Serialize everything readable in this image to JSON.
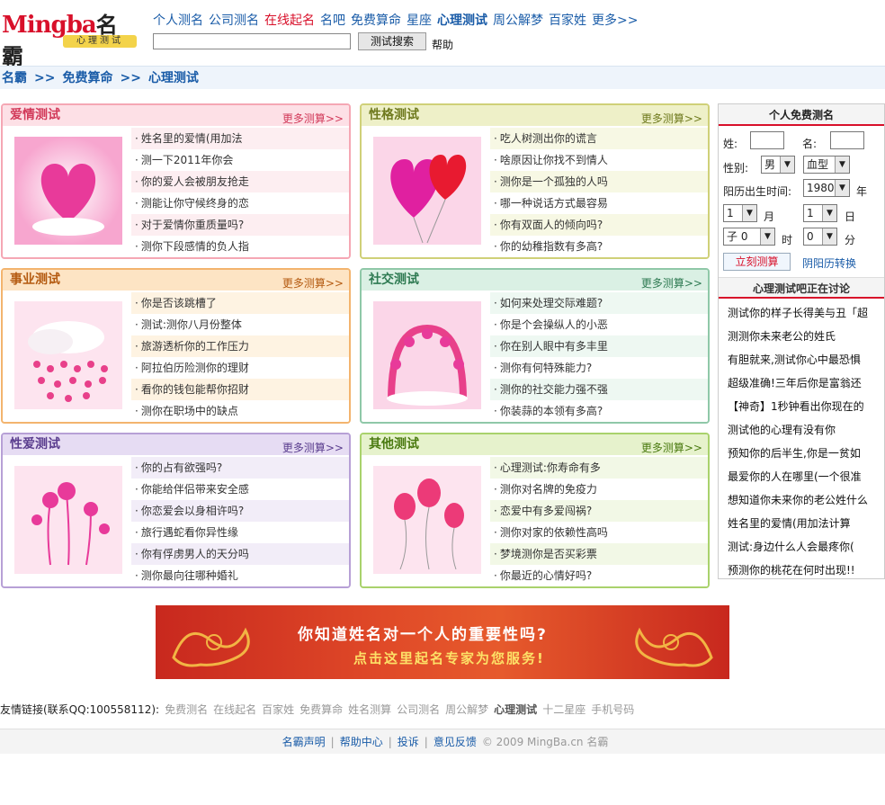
{
  "header": {
    "logo_text": "Mingba",
    "logo_cn": "名霸",
    "logo_tagline": "心理测试",
    "nav": [
      {
        "label": "个人测名",
        "style": "normal"
      },
      {
        "label": "公司测名",
        "style": "normal"
      },
      {
        "label": "在线起名",
        "style": "red"
      },
      {
        "label": "名吧",
        "style": "normal"
      },
      {
        "label": "免费算命",
        "style": "normal"
      },
      {
        "label": "星座",
        "style": "normal"
      },
      {
        "label": "心理测试",
        "style": "bold"
      },
      {
        "label": "周公解梦",
        "style": "normal"
      },
      {
        "label": "百家姓",
        "style": "normal"
      },
      {
        "label": "更多>>",
        "style": "normal"
      }
    ],
    "search_value": "",
    "search_button": "测试搜索",
    "help": "帮助"
  },
  "breadcrumb": [
    "名霸",
    ">>",
    "免费算命",
    ">>",
    "心理测试"
  ],
  "panels": [
    {
      "title": "爱情测试",
      "more": "更多测算>>",
      "items": [
        "姓名里的爱情(用加法",
        "测一下2011年你会",
        "你的爱人会被朋友抢走",
        "测能让你守候终身的恋",
        "对于爱情你重质量吗?",
        "测你下段感情的负人指"
      ]
    },
    {
      "title": "性格测试",
      "more": "更多测算>>",
      "items": [
        "吃人树测出你的谎言",
        "啥原因让你找不到情人",
        "测你是一个孤独的人吗",
        "哪一种说话方式最容易",
        "你有双面人的倾向吗?",
        "你的幼稚指数有多高?"
      ]
    },
    {
      "title": "事业测试",
      "more": "更多测算>>",
      "items": [
        "你是否该跳槽了",
        "测试:测你八月份整体",
        "旅游透析你的工作压力",
        "阿拉伯历险测你的理财",
        "看你的钱包能帮你招财",
        "测你在职场中的缺点"
      ]
    },
    {
      "title": "社交测试",
      "more": "更多测算>>",
      "items": [
        "如何来处理交际难题?",
        "你是个会操纵人的小恶",
        "你在别人眼中有多丰里",
        "测你有何特殊能力?",
        "测你的社交能力强不强",
        "你装蒜的本领有多高?"
      ]
    },
    {
      "title": "性爱测试",
      "more": "更多测算>>",
      "items": [
        "你的占有欲强吗?",
        "你能给伴侣带来安全感",
        "你恋爱会以身相许吗?",
        "旅行遇蛇看你异性缘",
        "你有俘虏男人的天分吗",
        "测你最向往哪种婚礼"
      ]
    },
    {
      "title": "其他测试",
      "more": "更多测算>>",
      "items": [
        "心理测试:你寿命有多",
        "测你对名牌的免疫力",
        "恋爱中有多爱闯祸?",
        "测你对家的依赖性高吗",
        "梦境测你是否买彩票",
        "你最近的心情好吗?"
      ]
    }
  ],
  "panel_colors": [
    "#f5a7b4",
    "#cfd078",
    "#f3b46e",
    "#8fc8a8",
    "#b7a0d6",
    "#a9d26c"
  ],
  "form": {
    "title": "个人免费测名",
    "surname_label": "姓:",
    "name_label": "名:",
    "gender_label": "性别:",
    "gender_value": "男",
    "blood_value": "血型",
    "birth_label": "阳历出生时间:",
    "year_value": "1980",
    "year_unit": "年",
    "month_value": "1",
    "month_unit": "月",
    "day_value": "1",
    "day_unit": "日",
    "hour_value": "子 0",
    "hour_unit": "时",
    "minute_value": "0",
    "minute_unit": "分",
    "submit": "立刻测算",
    "convert_link": "阴阳历转换"
  },
  "discussion": {
    "title": "心理测试吧正在讨论",
    "items": [
      "测试你的样子长得美与丑「超",
      "测测你未来老公的姓氏",
      "有胆就来,测试你心中最恐惧",
      "超级准确!三年后你是富翁还",
      "【神奇】1秒钟看出你现在的",
      "测试他的心理有没有你",
      "预知你的后半生,你是一贫如",
      "最爱你的人在哪里(一个很准",
      "想知道你未来你的老公姓什么",
      "姓名里的爱情(用加法计算",
      "测试:身边什么人会最疼你(",
      "预测你的桃花在何时出现!!"
    ]
  },
  "banner": {
    "line1": "你知道姓名对一个人的重要性吗?",
    "line2": "点击这里起名专家为您服务!"
  },
  "friends": {
    "label": "友情链接(联系QQ:100558112):",
    "links": [
      "免费测名",
      "在线起名",
      "百家姓",
      "免费算命",
      "姓名测算",
      "公司测名",
      "周公解梦",
      "心理测试",
      "十二星座",
      "手机号码"
    ]
  },
  "footer": {
    "links": [
      "名霸声明",
      "帮助中心",
      "投诉",
      "意见反馈"
    ],
    "separator": "|",
    "copyright": "© 2009 MingBa.cn 名霸"
  }
}
